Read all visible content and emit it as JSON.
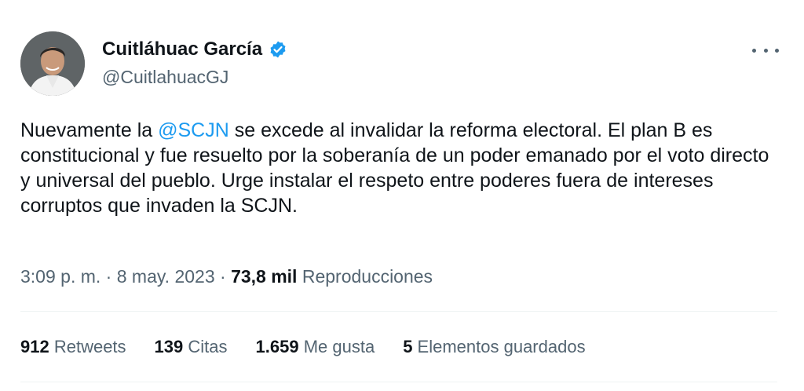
{
  "author": {
    "display_name": "Cuitláhuac García",
    "handle": "@CuitlahuacGJ",
    "verified_icon": "verified-badge-icon",
    "avatar_icon": "avatar-photo"
  },
  "more_icon": "more-horizontal-icon",
  "tweet": {
    "text_before": "Nuevamente la ",
    "mention": "@SCJN",
    "text_after": " se excede al invalidar la reforma electoral. El plan B es constitucional y fue resuelto por la soberanía de un poder emanado por el voto directo y universal del pueblo. Urge instalar el respeto entre poderes fuera de intereses corruptos que invaden la SCJN."
  },
  "meta": {
    "time": "3:09 p. m.",
    "sep1": " · ",
    "date": "8 may. 2023",
    "sep2": " · ",
    "views": "73,8 mil",
    "views_label": " Reproducciones"
  },
  "stats": [
    {
      "value": "912",
      "label": " Retweets"
    },
    {
      "value": "139",
      "label": " Citas"
    },
    {
      "value": "1.659",
      "label": " Me gusta"
    },
    {
      "value": "5",
      "label": " Elementos guardados"
    }
  ],
  "colors": {
    "accent": "#1d9bf0",
    "text": "#0f1419",
    "secondary": "#536471",
    "divider": "#eff3f4"
  }
}
